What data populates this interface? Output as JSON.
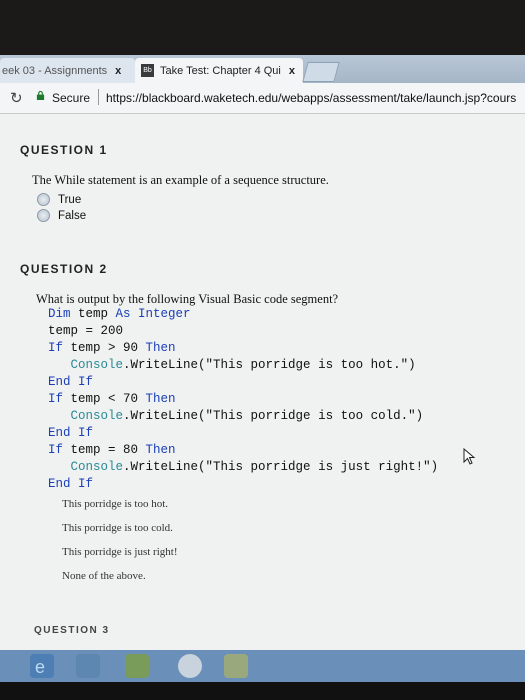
{
  "tabs": [
    {
      "label": "eek 03 - Assignments",
      "close": "x"
    },
    {
      "label": "Take Test: Chapter 4 Qui",
      "close": "x",
      "favicon": "Bb"
    }
  ],
  "address": {
    "secure_label": "Secure",
    "url": "https://blackboard.waketech.edu/webapps/assessment/take/launch.jsp?cours"
  },
  "questions": [
    {
      "header": "QUESTION 1",
      "text": "The While statement is an example of a sequence structure.",
      "options": [
        "True",
        "False"
      ]
    },
    {
      "header": "QUESTION 2",
      "text": "What is output by the following Visual Basic code segment?",
      "options": [
        "This porridge is too hot.",
        "This porridge is too cold.",
        "This porridge is just right!",
        "None of the above."
      ]
    },
    {
      "header": "QUESTION 3"
    }
  ],
  "code": {
    "l1_kw": "Dim",
    "l1_var": " temp ",
    "l1_kw2": "As Integer",
    "l2": "temp = 200",
    "l3_kw": "If",
    "l3_mid": " temp > 90 ",
    "l3_kw2": "Then",
    "l4_cls": "Console",
    "l4_rest": ".WriteLine(\"This porridge is too hot.\")",
    "l5": "End If",
    "l6_kw": "If",
    "l6_mid": " temp < 70 ",
    "l6_kw2": "Then",
    "l7_cls": "Console",
    "l7_rest": ".WriteLine(\"This porridge is too cold.\")",
    "l8": "End If",
    "l9_kw": "If",
    "l9_mid": " temp = 80 ",
    "l9_kw2": "Then",
    "l10_cls": "Console",
    "l10_rest": ".WriteLine(\"This porridge is just right!\")",
    "l11": "End If"
  }
}
